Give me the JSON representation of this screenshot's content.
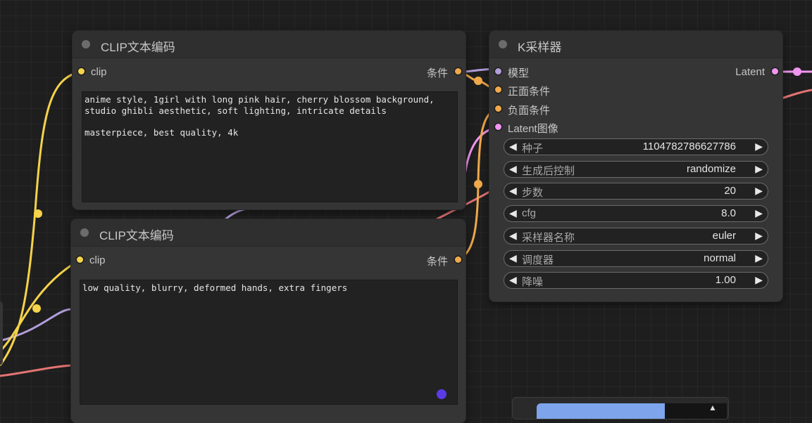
{
  "colors": {
    "clip": "#f5d34a",
    "conditioning": "#f0a94a",
    "model": "#b39ddb",
    "latent": "#f095f0",
    "vae": "#e57373",
    "accent_dot": "#5b3be6"
  },
  "nodes": {
    "clip_pos": {
      "title": "CLIP文本编码",
      "input_label": "clip",
      "output_label": "条件",
      "text": "anime style, 1girl with long pink hair, cherry blossom background,\nstudio ghibli aesthetic, soft lighting, intricate details\n\nmasterpiece, best quality, 4k"
    },
    "clip_neg": {
      "title": "CLIP文本编码",
      "input_label": "clip",
      "output_label": "条件",
      "text": "low quality, blurry, deformed hands, extra fingers"
    },
    "ksampler": {
      "title": "K采样器",
      "inputs": [
        "模型",
        "正面条件",
        "负面条件",
        "Latent图像"
      ],
      "output_label": "Latent",
      "widgets": [
        {
          "label": "种子",
          "value": "1104782786627786"
        },
        {
          "label": "生成后控制",
          "value": "randomize"
        },
        {
          "label": "步数",
          "value": "20"
        },
        {
          "label": "cfg",
          "value": "8.0"
        },
        {
          "label": "采样器名称",
          "value": "euler"
        },
        {
          "label": "调度器",
          "value": "normal"
        },
        {
          "label": "降噪",
          "value": "1.00"
        }
      ]
    }
  }
}
